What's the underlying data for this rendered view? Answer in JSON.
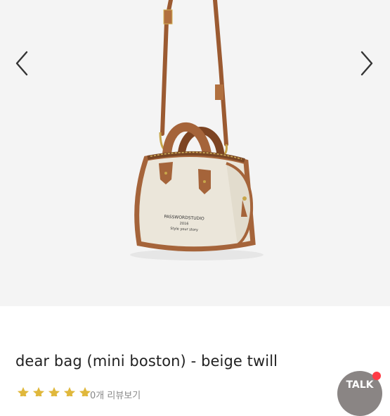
{
  "product": {
    "name": "dear bag (mini boston) - beige twill",
    "image_alt": "dear bag mini boston beige twill",
    "bag_print_lines": [
      "PASSWORDSTUDIO",
      "2016",
      "Style your story"
    ]
  },
  "gallery": {
    "prev_icon": "chevron-left-icon",
    "next_icon": "chevron-right-icon"
  },
  "rating": {
    "stars": 5,
    "review_count_text": "0개 리뷰보기"
  },
  "talk_button": {
    "label": "TALK",
    "has_notification": true
  },
  "colors": {
    "gallery_bg": "#f4f4f4",
    "bag_body": "#ebe6da",
    "leather": "#a5643a",
    "strap": "#9b5a31",
    "star": "#e0b83c",
    "talk_bg": "#8a8584",
    "notification": "#ff3b45"
  }
}
